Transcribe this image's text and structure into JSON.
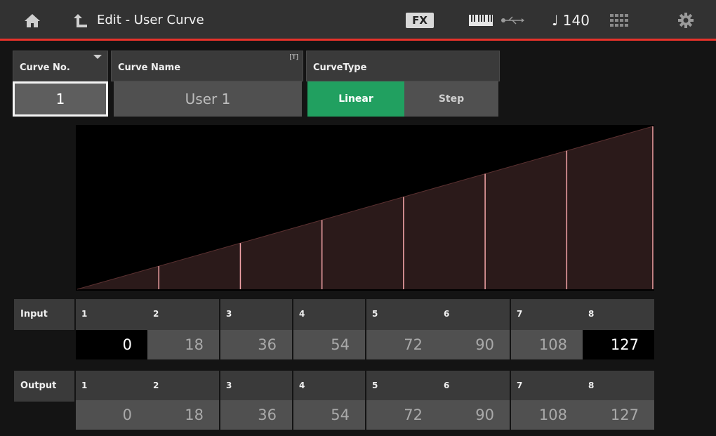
{
  "header": {
    "title": "Edit - User Curve",
    "fx_label": "FX",
    "tempo": "♩ 140",
    "icons": [
      "home-icon",
      "back-arrow-icon",
      "keyboard-icon",
      "usb-icon",
      "grid-icon",
      "gear-icon"
    ],
    "accent_color": "#e8322a"
  },
  "params": {
    "curve_no": {
      "label": "Curve No.",
      "value": "1"
    },
    "curve_name": {
      "label": "Curve Name",
      "value": "User 1",
      "tag": "[T]"
    },
    "curve_type": {
      "label": "CurveType",
      "options": [
        "Linear",
        "Step"
      ],
      "selected": "Linear",
      "selected_color": "#21a060"
    }
  },
  "graph": {
    "type": "linear",
    "points": [
      0,
      18,
      36,
      54,
      72,
      90,
      108,
      127
    ],
    "fill_color": "#2b1a1a",
    "line_color": "#f4a4a8",
    "max": 127
  },
  "input": {
    "label": "Input",
    "cells": [
      {
        "index": "1",
        "value": "0",
        "highlighted": true
      },
      {
        "index": "2",
        "value": "18",
        "highlighted": false
      },
      {
        "index": "3",
        "value": "36",
        "highlighted": false
      },
      {
        "index": "4",
        "value": "54",
        "highlighted": false
      },
      {
        "index": "5",
        "value": "72",
        "highlighted": false
      },
      {
        "index": "6",
        "value": "90",
        "highlighted": false
      },
      {
        "index": "7",
        "value": "108",
        "highlighted": false
      },
      {
        "index": "8",
        "value": "127",
        "highlighted": true
      }
    ]
  },
  "output": {
    "label": "Output",
    "cells": [
      {
        "index": "1",
        "value": "0"
      },
      {
        "index": "2",
        "value": "18"
      },
      {
        "index": "3",
        "value": "36"
      },
      {
        "index": "4",
        "value": "54"
      },
      {
        "index": "5",
        "value": "72"
      },
      {
        "index": "6",
        "value": "90"
      },
      {
        "index": "7",
        "value": "108"
      },
      {
        "index": "8",
        "value": "127"
      }
    ]
  }
}
